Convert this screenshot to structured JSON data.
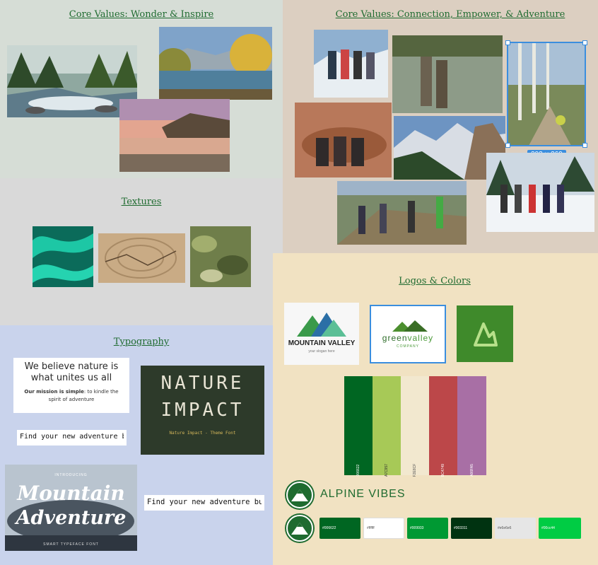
{
  "panels": {
    "wonder_title": "Core Values: Wonder & Inspire",
    "connection_title": "Core Values: Connection, Empower, & Adventure",
    "textures_title": "Textures",
    "typography_title": "Typography",
    "logos_title": "Logos & Colors"
  },
  "selection": {
    "dimensions": "202 × 269"
  },
  "typography": {
    "headline": "We believe nature is what unites us all",
    "mission_bold": "Our mission is simple",
    "mission_rest": ": to kindle the spirit of adventure",
    "tagline_1": "Find your new adventure buddy",
    "tagline_2": "Find your new adventure buddy",
    "nature_word_1": "NATURE",
    "nature_word_2": "IMPACT",
    "nature_sub": "Nature Impact - Theme Font",
    "mountain_word_1": "Mountain",
    "mountain_word_2": "Adventure",
    "mountain_top": "INTRODUCING",
    "mountain_sub": "SMART TYPEFACE FONT"
  },
  "logos": {
    "mountain_valley_name": "MOUNTAIN VALLEY",
    "mountain_valley_slogan": "your slogan here",
    "green_valley_name_1": "green",
    "green_valley_name_2": "valley",
    "green_valley_sub": "COMPANY",
    "alpine_name": "ALPINE VIBES"
  },
  "palette_swatches": [
    {
      "hex": "#006622",
      "label": "006622"
    },
    {
      "hex": "#A7C957",
      "label": "A7C957"
    },
    {
      "hex": "#F2E8CF",
      "label": "F2E8CF"
    },
    {
      "hex": "#BC4749",
      "label": "BC4749"
    },
    {
      "hex": "#A86FA5",
      "label": "A86FA5"
    }
  ],
  "alpine_chips": [
    {
      "hex": "#006622",
      "label": "#006622"
    },
    {
      "hex": "#ffffff",
      "label": "#ffffff"
    },
    {
      "hex": "#009933",
      "label": "#009933"
    },
    {
      "hex": "#003311",
      "label": "#003311"
    },
    {
      "hex": "#e6e6e6",
      "label": "#e6e6e6"
    },
    {
      "hex": "#00cc44",
      "label": "#00cc44"
    }
  ]
}
